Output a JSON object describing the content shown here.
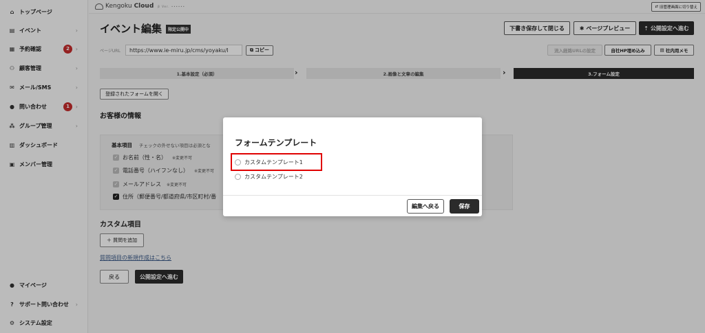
{
  "sidebar": {
    "items": [
      {
        "label": "トップページ",
        "icon": "home-icon"
      },
      {
        "label": "イベント",
        "icon": "document-icon"
      },
      {
        "label": "予約確認",
        "icon": "calendar-icon",
        "badge": "2"
      },
      {
        "label": "顧客管理",
        "icon": "people-icon"
      },
      {
        "label": "メール/SMS",
        "icon": "mail-icon"
      },
      {
        "label": "問い合わせ",
        "icon": "chat-icon",
        "badge": "1"
      },
      {
        "label": "グループ管理",
        "icon": "group-icon"
      },
      {
        "label": "ダッシュボード",
        "icon": "chart-icon"
      },
      {
        "label": "メンバー管理",
        "icon": "grid-icon"
      }
    ],
    "bottom_items": [
      {
        "label": "マイページ",
        "icon": "person-icon"
      },
      {
        "label": "サポート問い合わせ",
        "icon": "help-icon"
      },
      {
        "label": "システム設定",
        "icon": "gear-icon"
      }
    ]
  },
  "topbar": {
    "logo_light": "Kengoku",
    "logo_bold": "Cloud",
    "logo_tagline": "β Ver. ••••••",
    "switch_label": "旧管理画面に切り替え"
  },
  "header": {
    "title": "イベント編集",
    "badge": "限定公開中",
    "save_close": "下書き保存して閉じる",
    "preview": "ページプレビュー",
    "publish": "公開設定へ進む"
  },
  "url": {
    "label": "ページURL",
    "value": "https://www.ie-miru.jp/cms/yoyaku/l",
    "copy": "コピー",
    "btn1": "流入経路URLの設定",
    "btn2": "自社HP埋め込み",
    "btn3": "社内用メモ"
  },
  "steps": [
    "1.基本設定（必須）",
    "2.画像と文章の編集",
    "3.フォーム設定"
  ],
  "form": {
    "open_registered": "登録されたフォームを開く",
    "customer_info": "お客様の情報",
    "basic_title": "基本項目",
    "basic_note": "チェックの外せない項目は必須とな",
    "fields": [
      {
        "label": "お名前（性・名）",
        "note": "※変更不可"
      },
      {
        "label": "電話番号（ハイフンなし）",
        "note": "※変更不可"
      },
      {
        "label": "メールアドレス",
        "note": "※変更不可"
      },
      {
        "label": "住所（郵便番号/都道府県/市区町村/番",
        "note": ""
      }
    ],
    "custom_title": "カスタム項目",
    "add_question": "＋ 質問を追加",
    "new_question_link": "質問項目の新規作成はこちら",
    "back": "戻る",
    "next": "公開設定へ進む"
  },
  "modal": {
    "title": "フォームテンプレート",
    "options": [
      "カスタムテンプレート1",
      "カスタムテンプレート2"
    ],
    "back": "編集へ戻る",
    "save": "保存"
  }
}
